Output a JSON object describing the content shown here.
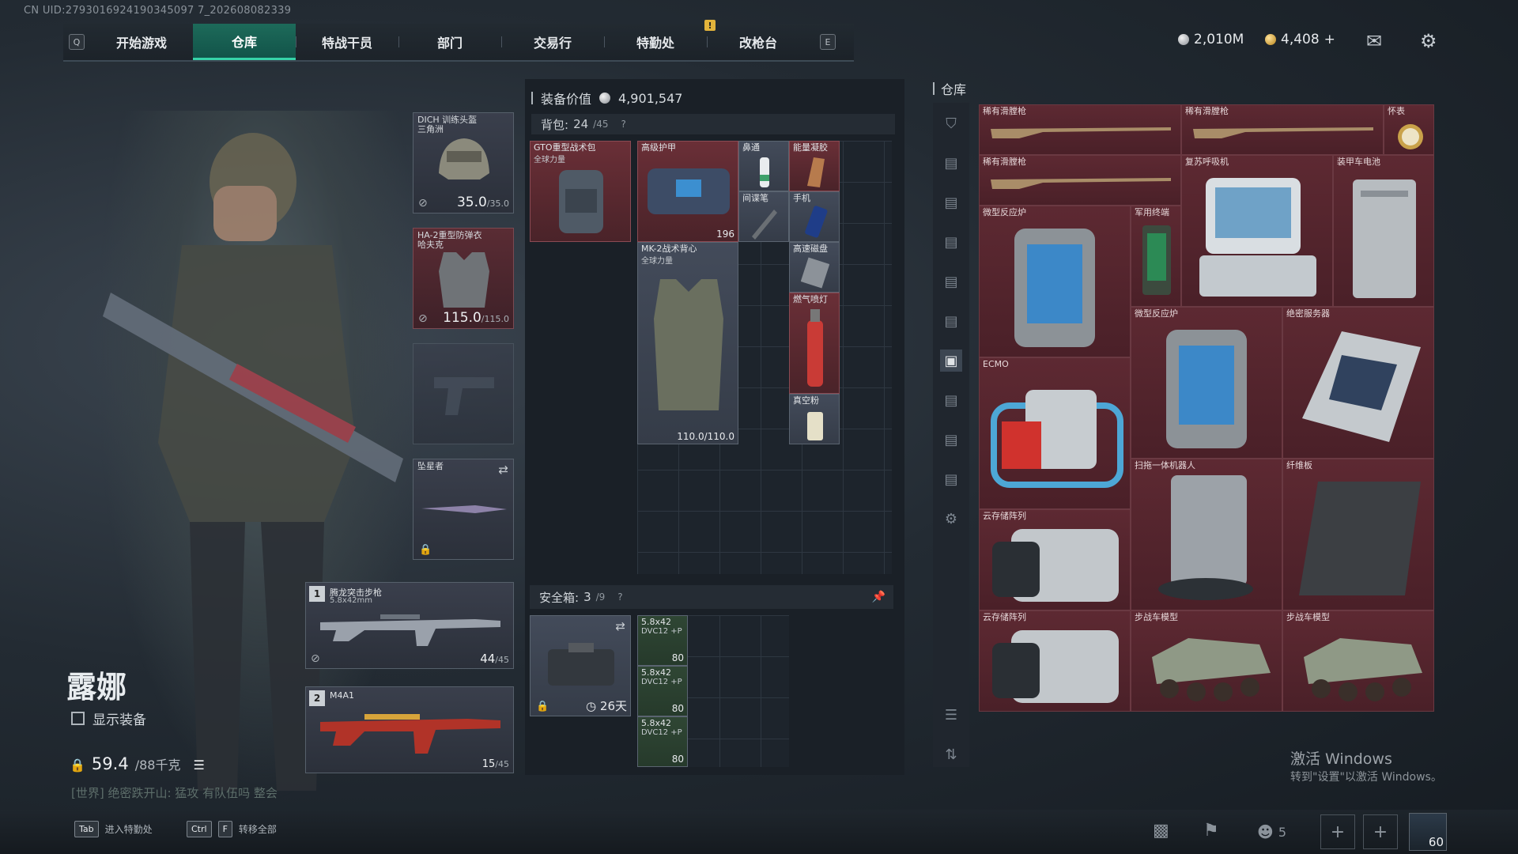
{
  "uid": "CN UID:2793016924190345097 7_202608082339",
  "nav": {
    "left_key": "Q",
    "right_key": "E",
    "alert": "!",
    "tabs": [
      {
        "label": "开始游戏"
      },
      {
        "label": "仓库",
        "active": true
      },
      {
        "label": "特战干员"
      },
      {
        "label": "部门"
      },
      {
        "label": "交易行"
      },
      {
        "label": "特勤处"
      },
      {
        "label": "改枪台"
      }
    ]
  },
  "currency": {
    "silver": "2,010M",
    "gold": "4,408",
    "gold_add": "+"
  },
  "icons": {
    "mail": "mail-icon",
    "settings": "gear-icon"
  },
  "character": {
    "name": "露娜",
    "show_equip_label": "显示装备",
    "weight_value": "59.4",
    "weight_max": "/88千克",
    "chat": "[世界] 绝密跌开山: 猛攻 有队伍吗 整会"
  },
  "equip": {
    "helmet": {
      "label": "DICH 训练头盔",
      "sub": "三角洲",
      "dur": "35.0",
      "dur_max": "/35.0"
    },
    "armor": {
      "label": "HA-2重型防弹衣",
      "sub": "哈夫克",
      "dur": "115.0",
      "dur_max": "/115.0"
    },
    "melee": {
      "label": "坠星者"
    },
    "weapon1": {
      "num": "1",
      "label": "腾龙突击步枪",
      "sub": "5.8x42mm",
      "ammo": "44",
      "ammo_max": "/45"
    },
    "weapon2": {
      "num": "2",
      "label": "M4A1",
      "ammo": "15",
      "ammo_max": "/45"
    }
  },
  "loadout": {
    "value_label": "装备价值",
    "value": "4,901,547",
    "backpack_label": "背包:",
    "backpack_used": "24",
    "backpack_max": "/45",
    "help": "?",
    "items": {
      "bag": {
        "label": "GTO重型战术包",
        "sub": "全球力量"
      },
      "armor": {
        "label": "高级护甲",
        "val": "196"
      },
      "nasal": {
        "label": "鼻通"
      },
      "gel": {
        "label": "能量凝胶"
      },
      "pen": {
        "label": "间谍笔"
      },
      "phone": {
        "label": "手机"
      },
      "vest": {
        "label": "MK-2战术背心",
        "sub": "全球力量",
        "val": "110.0/110.0"
      },
      "drive": {
        "label": "高速磁盘"
      },
      "torch": {
        "label": "燃气喷灯"
      },
      "powder": {
        "label": "真空粉"
      }
    },
    "safebox_label": "安全箱:",
    "safebox_used": "3",
    "safebox_max": "/9",
    "safebox_days": "26天",
    "ammo": [
      {
        "label": "5.8x42",
        "sub": "DVC12 +P",
        "count": "80"
      },
      {
        "label": "5.8x42",
        "sub": "DVC12 +P",
        "count": "80"
      },
      {
        "label": "5.8x42",
        "sub": "DVC12 +P",
        "count": "80"
      }
    ]
  },
  "stash": {
    "title": "仓库",
    "items": [
      {
        "label": "稀有滑膛枪"
      },
      {
        "label": "稀有滑膛枪"
      },
      {
        "label": "怀表"
      },
      {
        "label": "稀有滑膛枪"
      },
      {
        "label": "复苏呼吸机"
      },
      {
        "label": "装甲车电池"
      },
      {
        "label": "微型反应炉"
      },
      {
        "label": "军用终端"
      },
      {
        "label": "微型反应炉"
      },
      {
        "label": "绝密服务器"
      },
      {
        "label": "ECMO"
      },
      {
        "label": "扫拖一体机器人"
      },
      {
        "label": "纤维板"
      },
      {
        "label": "云存储阵列"
      },
      {
        "label": "云存储阵列"
      },
      {
        "label": "步战车模型"
      },
      {
        "label": "步战车模型"
      }
    ]
  },
  "bottom": {
    "tab_key": "Tab",
    "tab_label": "进入特勤处",
    "ctrl_key": "Ctrl",
    "f_key": "F",
    "ctrl_label": "转移全部",
    "friends": "5",
    "avatar_level": "60"
  },
  "windows": {
    "line1": "激活 Windows",
    "line2": "转到\"设置\"以激活 Windows。"
  }
}
